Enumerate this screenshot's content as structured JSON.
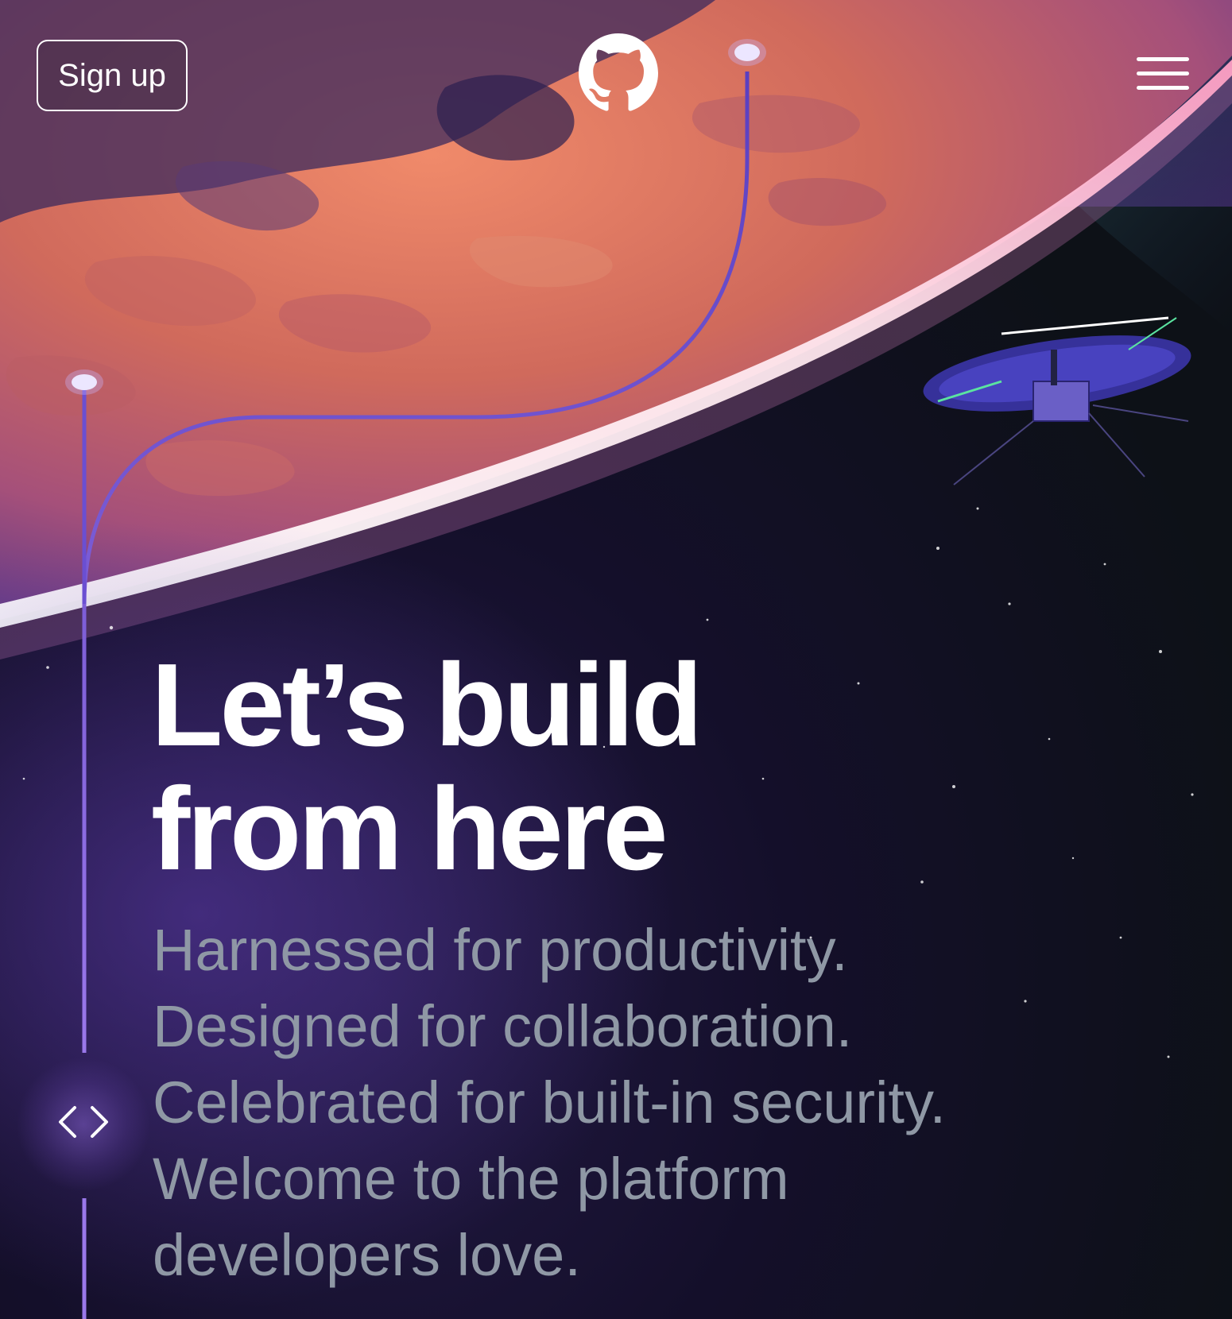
{
  "header": {
    "signup_label": "Sign up",
    "logo_icon": "github-octocat-icon",
    "menu_icon": "hamburger-menu-icon"
  },
  "hero": {
    "title_lines": [
      "Let’s build",
      "from here"
    ],
    "subtitle_lines": [
      "Harnessed for productivity.",
      "Designed for collaboration.",
      "Celebrated for built-in security.",
      "Welcome to the platform",
      "developers love."
    ],
    "code_icon": "code-brackets-icon"
  },
  "colors": {
    "background": "#0d1117",
    "planet": "#d9725f",
    "accent_line": "#6e4fd4",
    "subtitle": "#8f98a5",
    "text": "#ffffff"
  }
}
